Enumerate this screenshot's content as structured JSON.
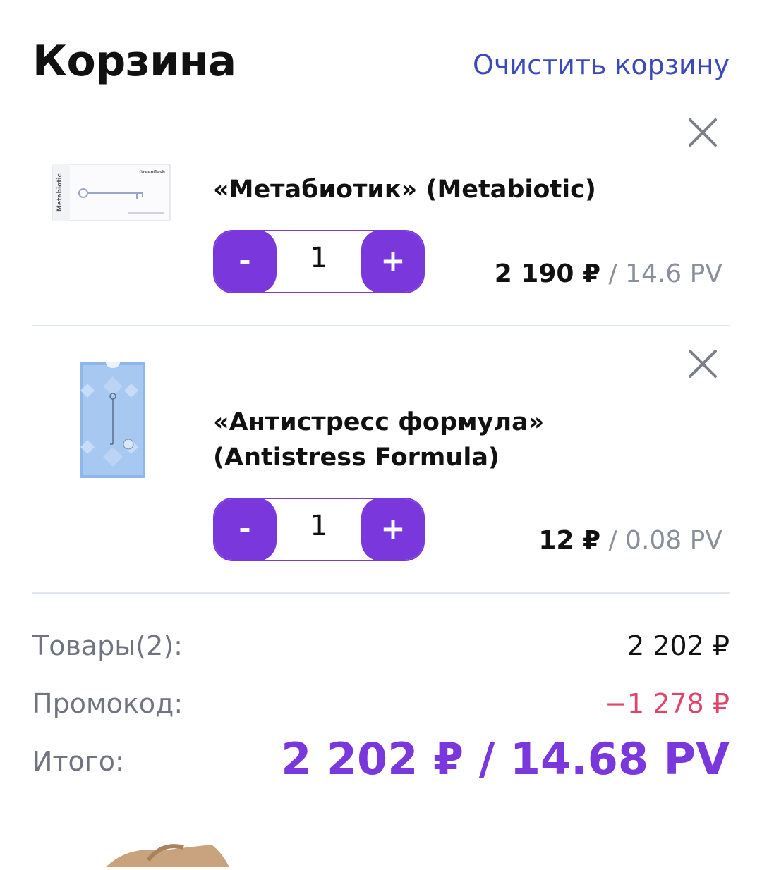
{
  "header": {
    "title": "Корзина",
    "clear_label": "Очистить корзину"
  },
  "items": [
    {
      "name": "«Метабиотик» (Metabiotic)",
      "quantity": "1",
      "price": "2 190 ₽",
      "pv": "/ 14.6 PV",
      "minus_label": "-",
      "plus_label": "+",
      "thumb_brand": "Greenflash",
      "thumb_name": "Metabiotic"
    },
    {
      "name": "«Антистресс формула» (Antistress Formula)",
      "quantity": "1",
      "price": "12 ₽",
      "pv": "/ 0.08 PV",
      "minus_label": "-",
      "plus_label": "+"
    }
  ],
  "summary": {
    "goods_label": "Товары(2):",
    "goods_value": "2 202 ₽",
    "promo_label": "Промокод:",
    "promo_value": "−1 278 ₽",
    "total_label": "Итого:",
    "total_value": "2 202 ₽ / 14.68 PV"
  },
  "colors": {
    "accent": "#7a38dc",
    "link": "#3b4ab8",
    "discount": "#e0446b",
    "muted": "#8a909b"
  }
}
